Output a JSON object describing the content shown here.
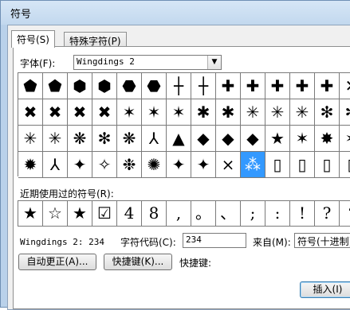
{
  "window": {
    "title": "符号"
  },
  "tabs": [
    {
      "label": "符号(S)",
      "active": true
    },
    {
      "label": "特殊字符(P)",
      "active": false
    }
  ],
  "font": {
    "label": "字体(F):",
    "value": "Wingdings 2"
  },
  "symbol_grid": {
    "selected_index": 51,
    "rows": [
      [
        "⬟",
        "⬟",
        "⬢",
        "⬢",
        "⬣",
        "⬣",
        "┼",
        "┼",
        "✚",
        "✚",
        "✚",
        "✚",
        "✚",
        "✕"
      ],
      [
        "✖",
        "✖",
        "✖",
        "✖",
        "✶",
        "✶",
        "✶",
        "✱",
        "✱",
        "✳",
        "✳",
        "✳",
        "✻",
        "✻"
      ],
      [
        "✳",
        "✳",
        "❋",
        "✻",
        "❋",
        "⅄",
        "▲",
        "◆",
        "◆",
        "◆",
        "★",
        "✶",
        "✸",
        "✶"
      ],
      [
        "✹",
        "⅄",
        "✦",
        "✧",
        "❉",
        "✺",
        "✦",
        "✦",
        "⨯",
        "⁂",
        "▯",
        "▯",
        "▯",
        "▯"
      ]
    ]
  },
  "recent": {
    "label": "近期使用过的符号(R):",
    "symbols": [
      "★",
      "☆",
      "★",
      "☑",
      "4",
      "8",
      ",",
      "。",
      "、",
      ";",
      ":",
      "!",
      "?",
      "“"
    ]
  },
  "info": {
    "char_name": "Wingdings 2: 234",
    "code_label": "字符代码(C):",
    "code_value": "234",
    "from_label": "来自(M):",
    "from_value": "符号(十进制)"
  },
  "buttons": {
    "autocorrect": "自动更正(A)...",
    "shortcut_key": "快捷键(K)...",
    "shortcut_label": "快捷键:",
    "insert": "插入(I)"
  }
}
